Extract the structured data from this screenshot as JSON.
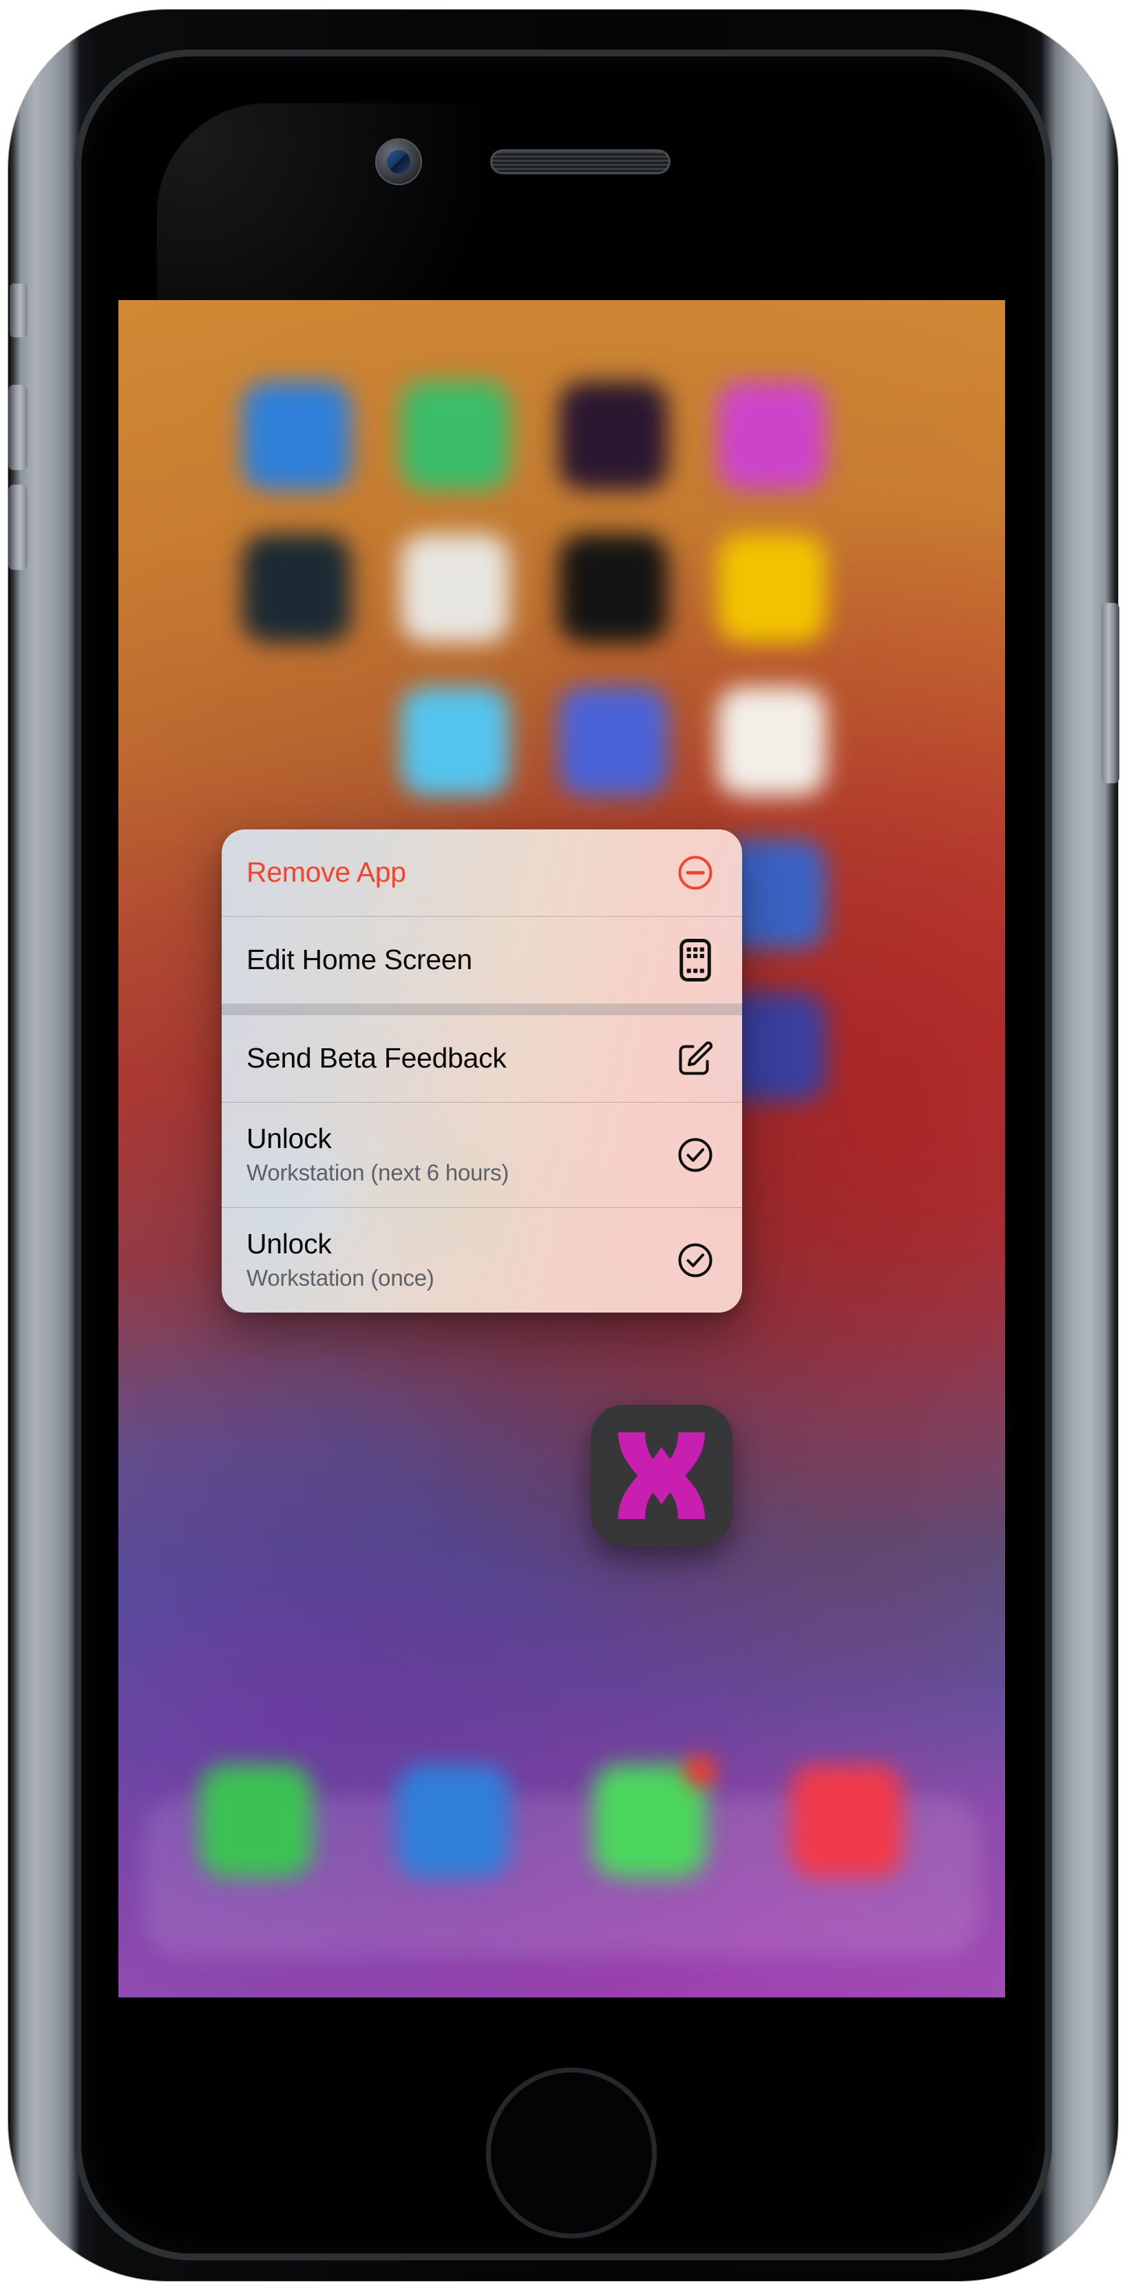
{
  "device": {
    "type": "iphone-se-home-button",
    "frame_color": "#9aa0a8",
    "screen_bg": "#c2552f",
    "hardware": {
      "earpiece": "earpiece-speaker",
      "camera": "front-camera",
      "home_button": "home-button",
      "mute_switch": "mute-switch",
      "volume_up": "volume-up-button",
      "volume_down": "volume-down-button",
      "power": "power-button"
    }
  },
  "context_menu": {
    "accent_destructive": "#f4442f",
    "items": [
      {
        "id": "remove-app",
        "title": "Remove App",
        "subtitle": "",
        "icon": "minus-circle-icon",
        "destructive": true
      },
      {
        "id": "edit-home-screen",
        "title": "Edit Home Screen",
        "subtitle": "",
        "icon": "iphone-apps-grid-icon",
        "destructive": false
      },
      {
        "id": "send-beta-feedback",
        "title": "Send Beta Feedback",
        "subtitle": "",
        "icon": "square-and-pencil-icon",
        "destructive": false
      },
      {
        "id": "unlock-workstation-6-hours",
        "title": "Unlock",
        "subtitle": "Workstation (next 6 hours)",
        "icon": "checkmark-circle-icon",
        "destructive": false
      },
      {
        "id": "unlock-workstation-once",
        "title": "Unlock",
        "subtitle": "Workstation (once)",
        "icon": "checkmark-circle-icon",
        "destructive": false
      }
    ]
  },
  "focused_app": {
    "name": "app-icon-x-logo",
    "background": "#37373a",
    "logo_color": "#c81fb0"
  },
  "home_screen": {
    "grid": [
      {
        "name": "app-icon-blue",
        "color": "#2f7fd8"
      },
      {
        "name": "app-icon-green",
        "color": "#3bbd6a"
      },
      {
        "name": "app-icon-dark-magenta",
        "color": "#2a1730"
      },
      {
        "name": "app-icon-magenta",
        "color": "#cc45c9"
      },
      {
        "name": "app-icon-dark-teal",
        "color": "#1b2a33"
      },
      {
        "name": "app-icon-white",
        "color": "#e8e6e0"
      },
      {
        "name": "app-icon-black",
        "color": "#141414"
      },
      {
        "name": "app-icon-yellow",
        "color": "#f2c300"
      },
      {
        "name": "app-icon-light-blue",
        "color": "#55c4ee"
      },
      {
        "name": "app-icon-indigo",
        "color": "#4a63d8"
      },
      {
        "name": "app-icon-white-sheet",
        "color": "#f2efe8"
      },
      {
        "name": "app-icon-blue-rounded",
        "color": "#3b63c4"
      },
      {
        "name": "app-icon-indigo-2",
        "color": "#3b3f9e"
      },
      {
        "name": "app-icon-blue-3",
        "color": "#2f6fd0"
      },
      {
        "name": "app-icon-dark-green",
        "color": "#17331f"
      },
      {
        "name": "app-icon-multicolor",
        "color": "#dfe3e8"
      }
    ],
    "dock": [
      {
        "name": "dock-icon-phone",
        "color": "#3cc253",
        "badge": false
      },
      {
        "name": "dock-icon-safari",
        "color": "#2f7fd8",
        "badge": false
      },
      {
        "name": "dock-icon-messages",
        "color": "#4cd65e",
        "badge": true
      },
      {
        "name": "dock-icon-music",
        "color": "#f03a4b",
        "badge": false
      }
    ]
  }
}
